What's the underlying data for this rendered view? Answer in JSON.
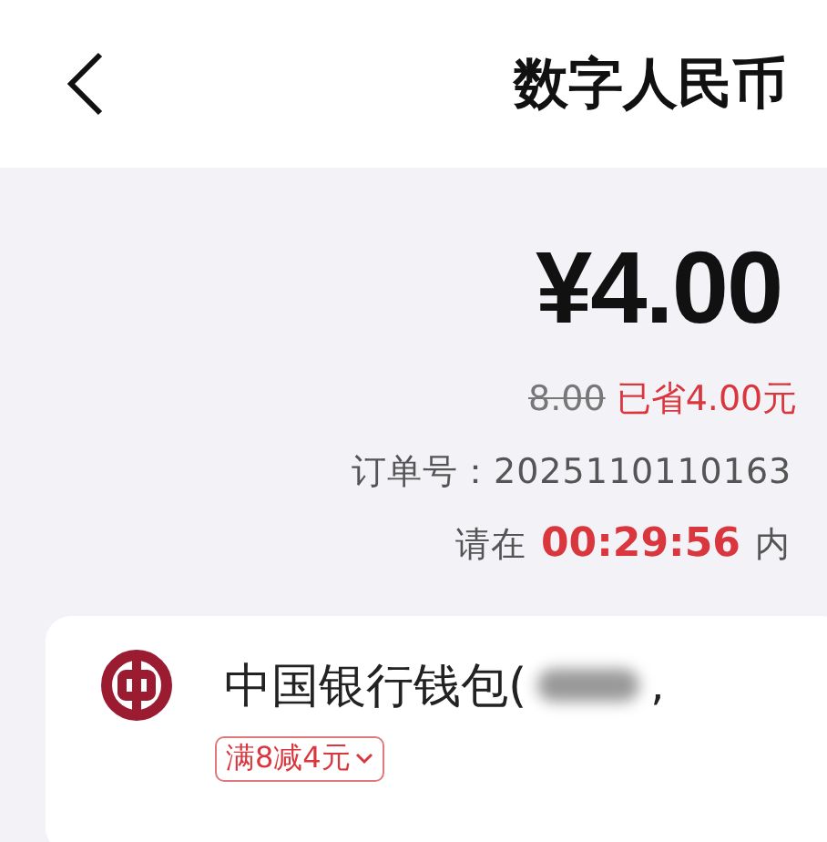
{
  "header": {
    "title": "数字人民币"
  },
  "order": {
    "amount": "¥4.00",
    "original_price": "8.00",
    "saving": "已省4.00元",
    "order_number": "订单号：2025110110163",
    "countdown_prefix": "请在",
    "countdown": "00:29:56",
    "countdown_suffix": "内"
  },
  "payment_method": {
    "bank_name": "中国银行钱包(",
    "masked": true,
    "name_suffix": ",",
    "promo_tag": "满8减4元"
  }
}
